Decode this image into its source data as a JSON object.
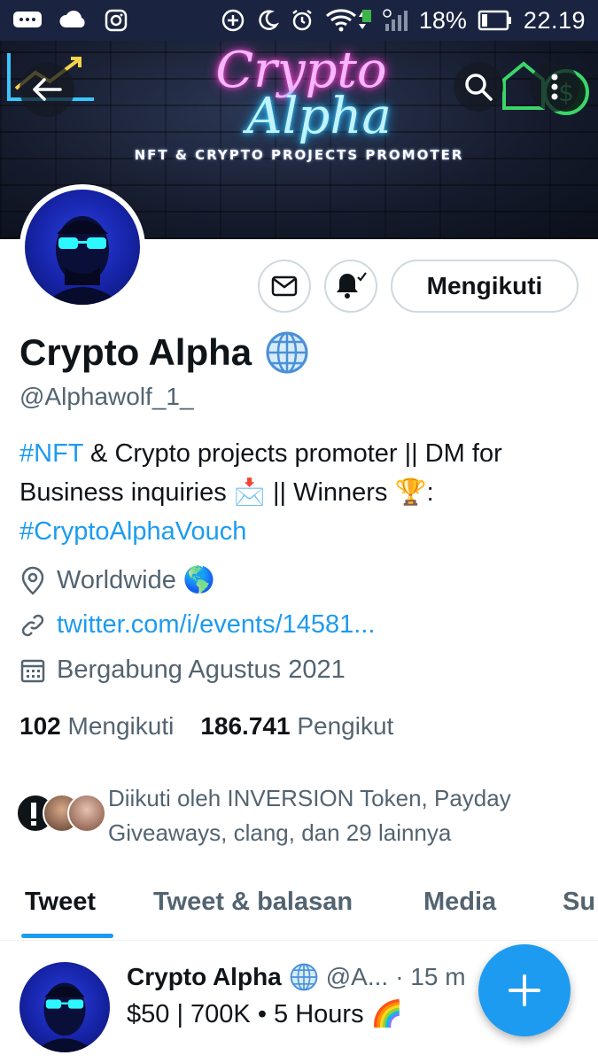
{
  "status_bar": {
    "battery": "18%",
    "time": "22.19",
    "icons": [
      "messages-icon",
      "cloud-icon",
      "instagram-icon",
      "data-saver-icon",
      "moon-icon",
      "alarm-icon",
      "wifi-icon",
      "signal-icon",
      "battery-icon"
    ]
  },
  "banner": {
    "title_line1": "Crypto",
    "title_line2": "Alpha",
    "subtitle": "NFT & CRYPTO PROJECTS PROMOTER"
  },
  "profile": {
    "display_name": "Crypto Alpha",
    "handle": "@Alphawolf_1_",
    "bio_hashtag1": "#NFT",
    "bio_text1": " & Crypto projects promoter || DM for Business inquiries 📩 || Winners 🏆:",
    "bio_hashtag2": "#CryptoAlphaVouch",
    "location": "Worldwide 🌎",
    "website": "twitter.com/i/events/14581...",
    "joined": "Bergabung Agustus 2021",
    "following_count": "102",
    "following_label": "Mengikuti",
    "followers_count": "186.741",
    "followers_label": "Pengikut",
    "followed_by": "Diikuti oleh INVERSION Token, Payday Giveaways, clang, dan 29 lainnya"
  },
  "actions": {
    "follow_label": "Mengikuti"
  },
  "tabs": [
    {
      "label": "Tweet"
    },
    {
      "label": "Tweet & balasan"
    },
    {
      "label": "Media"
    },
    {
      "label": "Su"
    }
  ],
  "tweet": {
    "name": "Crypto Alpha",
    "handle": "@A...",
    "time": "· 15 m",
    "text": "$50 | 700K • 5 Hours 🌈"
  },
  "colors": {
    "accent": "#1d9bf0",
    "status_bar": "#1a2440",
    "text_secondary": "#536471"
  }
}
